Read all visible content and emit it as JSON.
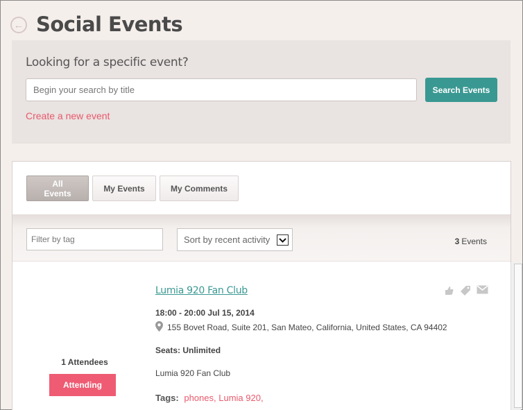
{
  "header": {
    "title": "Social Events",
    "back_glyph": "←"
  },
  "search": {
    "heading": "Looking for a specific event?",
    "placeholder": "Begin your search by title",
    "value": "",
    "button_label": "Search Events",
    "create_link": "Create a new event"
  },
  "tabs": [
    {
      "label": "All Events",
      "active": true
    },
    {
      "label": "My Events",
      "active": false
    },
    {
      "label": "My Comments",
      "active": false
    }
  ],
  "filters": {
    "tag_placeholder": "Filter by tag",
    "sort_selected": "Sort by recent activity",
    "count": "3",
    "count_label": "Events"
  },
  "event": {
    "title": "Lumia 920 Fan Club",
    "time": "18:00 - 20:00 Jul 15, 2014",
    "address": "155 Bovet Road, Suite 201, San Mateo, California, United States, CA 94402",
    "seats": "Seats: Unlimited",
    "description": "Lumia 920 Fan Club",
    "tags_label": "Tags:",
    "tags": [
      "phones",
      "Lumia 920"
    ],
    "tag_separator": ",",
    "attendees": "1 Attendees",
    "attending_label": "Attending",
    "action_icons": [
      "like-icon",
      "tag-icon",
      "mail-icon"
    ]
  },
  "colors": {
    "accent_teal": "#3a9892",
    "link_pink": "#e85a6c",
    "attending_pink": "#ee5b73"
  }
}
